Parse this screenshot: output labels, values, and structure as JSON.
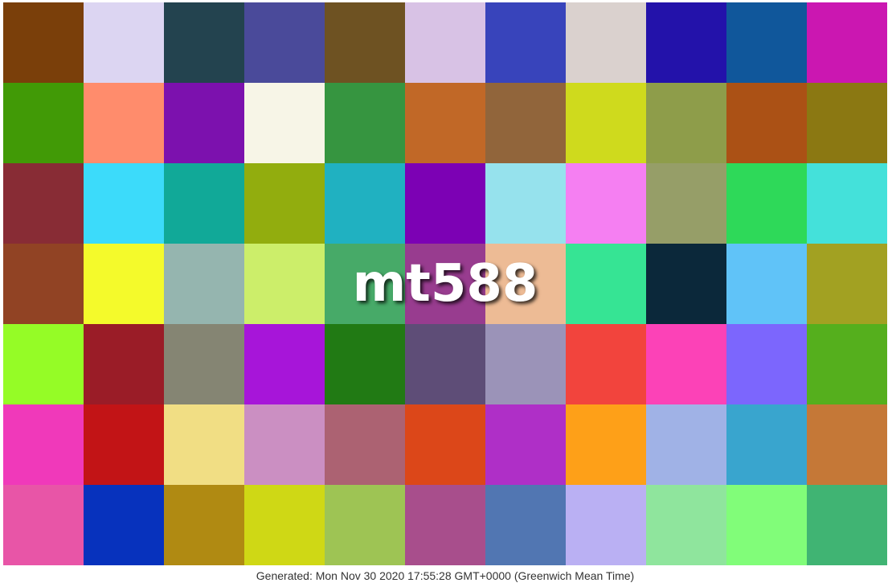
{
  "title": "mt588",
  "footer": "Generated: Mon Nov 30 2020 17:55:28 GMT+0000 (Greenwich Mean Time)",
  "grid": {
    "rows": [
      [
        "#7a3f0a",
        "#dcd5f2",
        "#23434f",
        "#4a4a9a",
        "#6e5222",
        "#d8c2e5",
        "#3844bb",
        "#dad1ce",
        "#2312aa",
        "#10579b",
        "#cb17b1"
      ],
      [
        "#419a06",
        "#ff8c6c",
        "#7c11ae",
        "#f7f5e7",
        "#369540",
        "#c16827",
        "#91653b",
        "#cfda1d",
        "#8e9d4a",
        "#ab5115",
        "#8b7812"
      ],
      [
        "#882c35",
        "#3cdbfa",
        "#11a998",
        "#92ad0e",
        "#20b1c1",
        "#7c01b4",
        "#96e2ed",
        "#f57ff2",
        "#969e68",
        "#2ed959",
        "#44e1da"
      ],
      [
        "#914324",
        "#f4fa2b",
        "#95b5af",
        "#ccee6a",
        "#47aa68",
        "#983c8f",
        "#edbb95",
        "#36e494",
        "#0b283a",
        "#60c3f8",
        "#a2a122"
      ],
      [
        "#95fc26",
        "#9a1c27",
        "#858573",
        "#a715d9",
        "#217a14",
        "#5e4d77",
        "#9b93b8",
        "#f2443d",
        "#fc42b7",
        "#7c66fd",
        "#55af1d"
      ],
      [
        "#f039ba",
        "#c21416",
        "#f1de84",
        "#cb8fc2",
        "#ac6272",
        "#dc4719",
        "#af2fc7",
        "#fea018",
        "#a0b2e6",
        "#39a5ce",
        "#c57837"
      ],
      [
        "#e855a7",
        "#0732bd",
        "#b08a12",
        "#cfd815",
        "#9ec454",
        "#a84e8c",
        "#5176b2",
        "#bab0f3",
        "#8fe59d",
        "#81fd79",
        "#40b473"
      ]
    ]
  }
}
